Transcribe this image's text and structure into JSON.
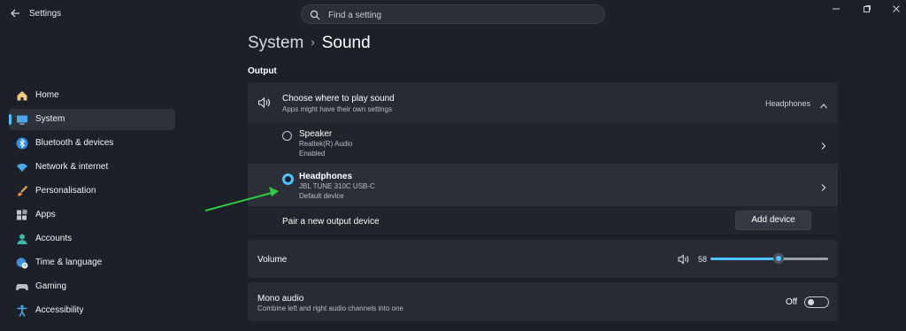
{
  "app": {
    "title": "Settings"
  },
  "search": {
    "placeholder": "Find a setting"
  },
  "window_controls": [
    "minimize",
    "maximize",
    "close"
  ],
  "sidebar": {
    "items": [
      {
        "label": "Home",
        "icon": "home-icon",
        "active": false
      },
      {
        "label": "System",
        "icon": "monitor-icon",
        "active": true
      },
      {
        "label": "Bluetooth & devices",
        "icon": "bluetooth-icon",
        "active": false
      },
      {
        "label": "Network & internet",
        "icon": "wifi-icon",
        "active": false
      },
      {
        "label": "Personalisation",
        "icon": "brush-icon",
        "active": false
      },
      {
        "label": "Apps",
        "icon": "apps-icon",
        "active": false
      },
      {
        "label": "Accounts",
        "icon": "person-icon",
        "active": false
      },
      {
        "label": "Time & language",
        "icon": "globe-clock-icon",
        "active": false
      },
      {
        "label": "Gaming",
        "icon": "gamepad-icon",
        "active": false
      },
      {
        "label": "Accessibility",
        "icon": "accessibility-icon",
        "active": false
      }
    ]
  },
  "breadcrumb": {
    "parent": "System",
    "separator": "›",
    "current": "Sound"
  },
  "output": {
    "section_title": "Output",
    "choose": {
      "title": "Choose where to play sound",
      "subtitle": "Apps might have their own settings",
      "selected": "Headphones"
    },
    "devices": [
      {
        "name": "Speaker",
        "detail": "Realtek(R) Audio",
        "status": "Enabled",
        "selected": false
      },
      {
        "name": "Headphones",
        "detail": "JBL TUNE 310C USB-C",
        "status": "Default device",
        "selected": true
      }
    ],
    "pair": {
      "label": "Pair a new output device",
      "button": "Add device"
    }
  },
  "volume": {
    "label": "Volume",
    "value": "58",
    "level": 0.58
  },
  "mono": {
    "title": "Mono audio",
    "subtitle": "Combine left and right audio channels into one",
    "state": "Off"
  },
  "colors": {
    "accent": "#4cc2ff",
    "background": "#1c2028",
    "card": "#272b33",
    "annotation_arrow": "#2ecc40"
  }
}
